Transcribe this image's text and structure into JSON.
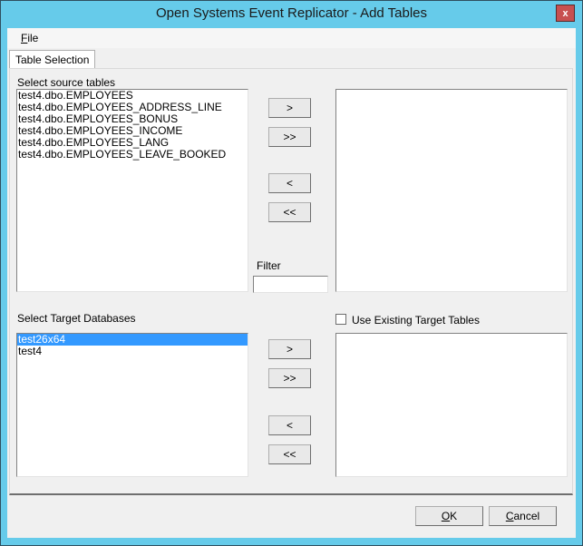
{
  "window": {
    "title": "Open Systems Event Replicator - Add Tables",
    "close_label": "x"
  },
  "menu": {
    "file_label": "File",
    "file_mnemonic": "F",
    "file_rest": "ile"
  },
  "tabs": [
    {
      "label": "Table Selection",
      "active": true
    }
  ],
  "source": {
    "label": "Select source tables",
    "items": [
      "test4.dbo.EMPLOYEES",
      "test4.dbo.EMPLOYEES_ADDRESS_LINE",
      "test4.dbo.EMPLOYEES_BONUS",
      "test4.dbo.EMPLOYEES_INCOME",
      "test4.dbo.EMPLOYEES_LANG",
      "test4.dbo.EMPLOYEES_LEAVE_BOOKED"
    ],
    "selected_items": []
  },
  "table_buttons": {
    "add": ">",
    "add_all": ">>",
    "remove": "<",
    "remove_all": "<<"
  },
  "filter": {
    "label": "Filter",
    "value": ""
  },
  "target": {
    "label": "Select Target Databases",
    "items": [
      "test26x64",
      "test4"
    ],
    "selected_index": 0,
    "selected_items": []
  },
  "db_buttons": {
    "add": ">",
    "add_all": ">>",
    "remove": "<",
    "remove_all": "<<"
  },
  "use_existing": {
    "label": "Use Existing Target Tables",
    "checked": false
  },
  "footer": {
    "ok_mnemonic": "O",
    "ok_rest": "K",
    "cancel_mnemonic": "C",
    "cancel_rest": "ancel"
  }
}
